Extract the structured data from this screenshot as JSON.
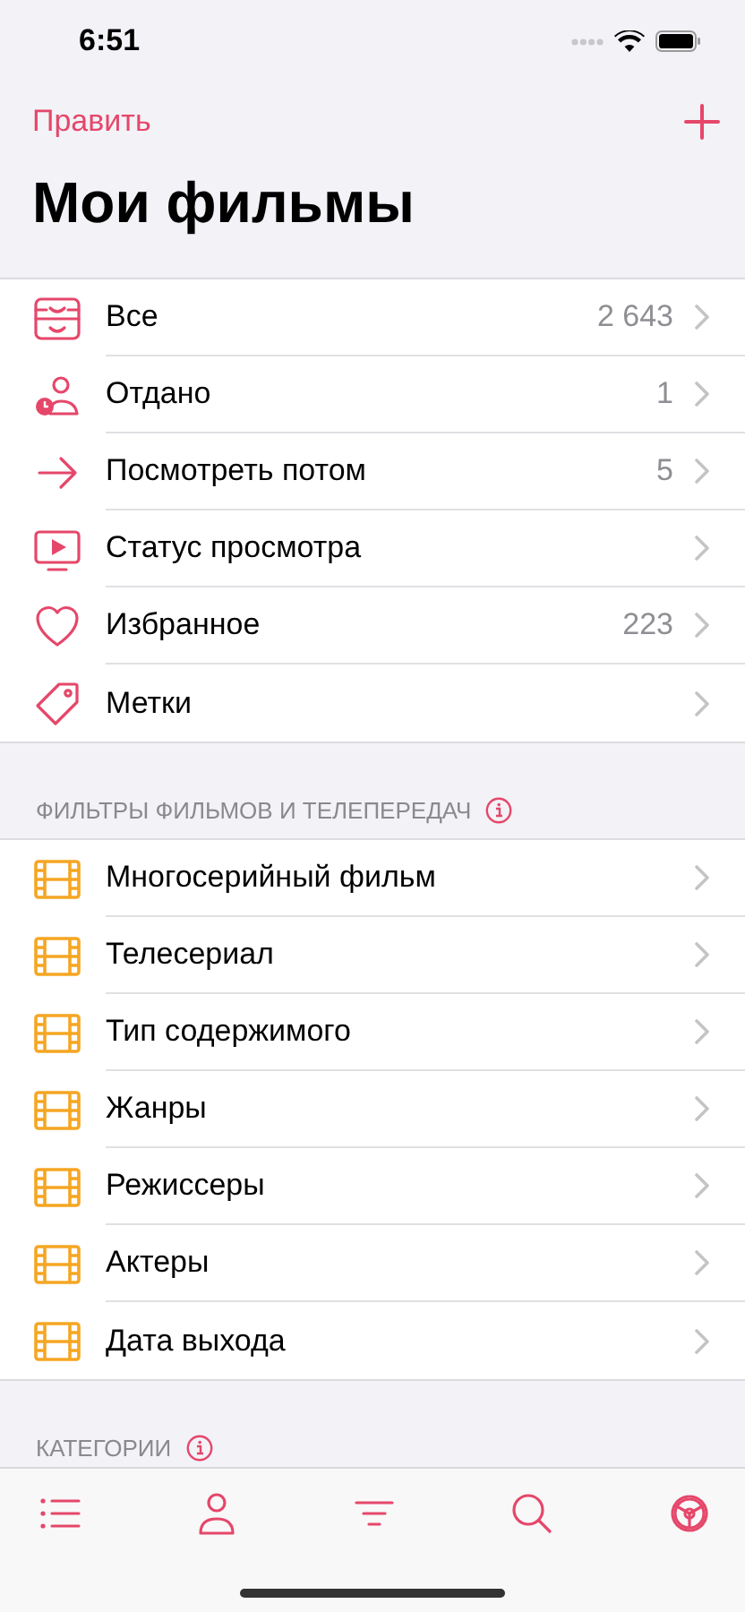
{
  "status_bar": {
    "time": "6:51"
  },
  "nav": {
    "edit": "Править"
  },
  "title": "Мои фильмы",
  "main_list": [
    {
      "kind": "tray",
      "label": "Все",
      "count": "2 643"
    },
    {
      "kind": "person",
      "label": "Отдано",
      "count": "1"
    },
    {
      "kind": "arrow",
      "label": "Посмотреть потом",
      "count": "5"
    },
    {
      "kind": "tv",
      "label": "Статус просмотра"
    },
    {
      "kind": "heart",
      "label": "Избранное",
      "count": "223"
    },
    {
      "kind": "tag",
      "label": "Метки"
    }
  ],
  "sections": [
    {
      "header": "ФИЛЬТРЫ ФИЛЬМОВ И ТЕЛЕПЕРЕДАЧ",
      "items": [
        {
          "kind": "film",
          "label": "Многосерийный фильм"
        },
        {
          "kind": "film",
          "label": "Телесериал"
        },
        {
          "kind": "film",
          "label": "Тип содержимого"
        },
        {
          "kind": "film",
          "label": "Жанры"
        },
        {
          "kind": "film",
          "label": "Режиссеры"
        },
        {
          "kind": "film",
          "label": "Актеры"
        },
        {
          "kind": "film",
          "label": "Дата выхода"
        }
      ]
    },
    {
      "header": "КАТЕГОРИИ"
    }
  ]
}
